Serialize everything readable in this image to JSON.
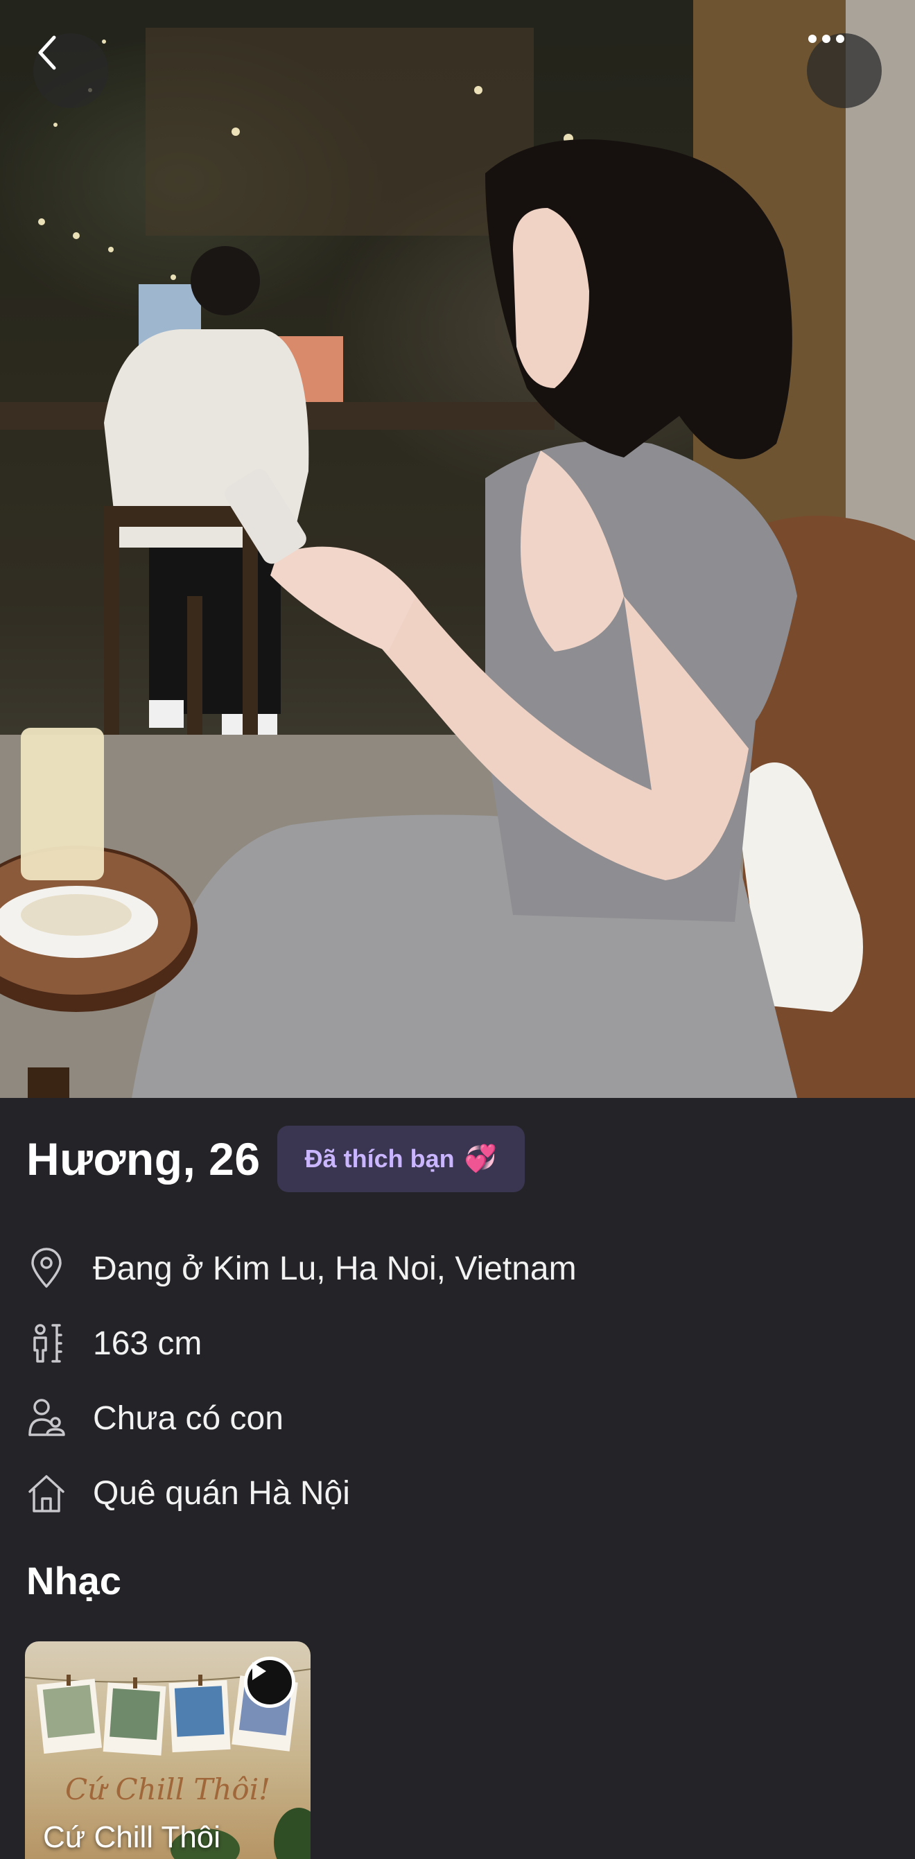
{
  "profile": {
    "name_age": "Hương, 26",
    "liked_badge": "Đã thích bạn",
    "liked_emoji": "💞"
  },
  "details": [
    {
      "icon": "location-pin-icon",
      "text": "Đang ở Kim Lu, Ha Noi, Vietnam"
    },
    {
      "icon": "height-icon",
      "text": "163 cm"
    },
    {
      "icon": "children-icon",
      "text": "Chưa có con"
    },
    {
      "icon": "home-icon",
      "text": "Quê quán Hà Nội"
    }
  ],
  "music": {
    "section_title": "Nhạc",
    "track_title": "Cứ Chill Thôi",
    "cover_text": "Cứ Chill Thôi!"
  },
  "colors": {
    "background": "#242428",
    "badge_bg": "#3a3550",
    "badge_text": "#c9b6ff"
  }
}
